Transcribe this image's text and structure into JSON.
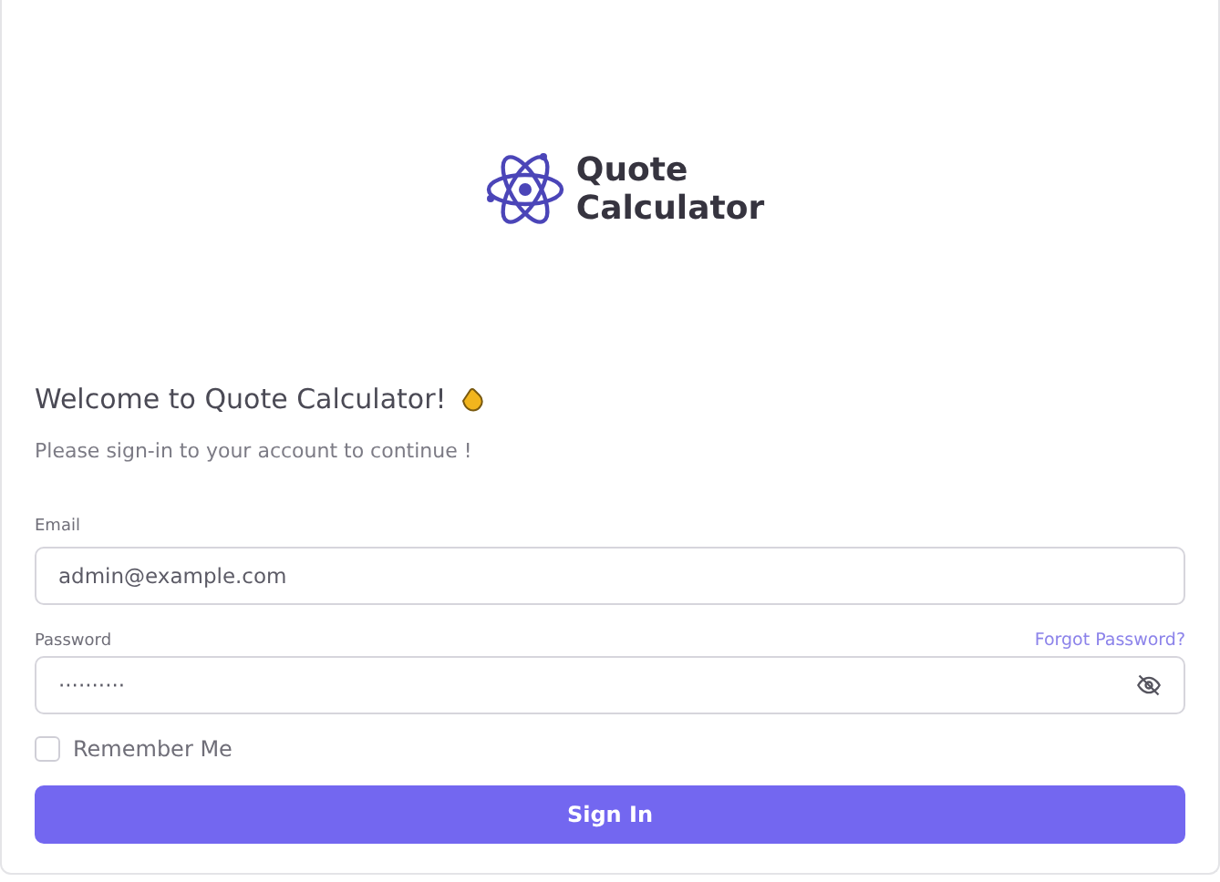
{
  "logo": {
    "line_1": "Quote",
    "line_2": "Calculator"
  },
  "heading": "Welcome to Quote Calculator!",
  "subtitle": "Please sign-in to your account to continue !",
  "email": {
    "label": "Email",
    "value": "admin@example.com"
  },
  "password": {
    "label": "Password",
    "value": "··········",
    "forgot_link": "Forgot Password?",
    "visible": false
  },
  "remember_me": {
    "label": "Remember Me",
    "checked": false
  },
  "submit": "Sign In"
}
